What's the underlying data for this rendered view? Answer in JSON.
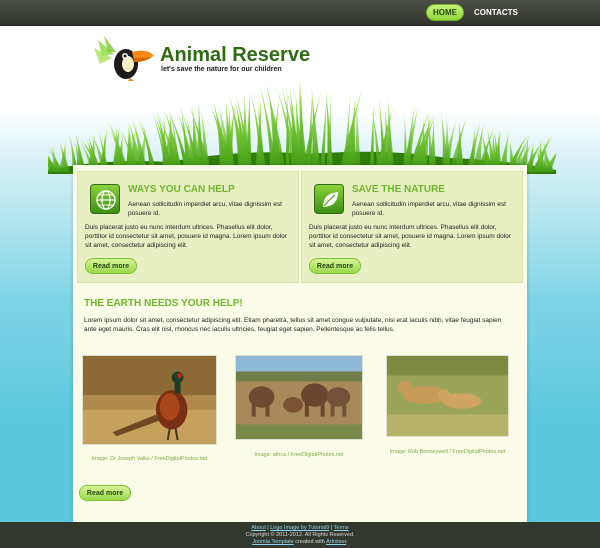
{
  "nav": {
    "home": "HOME",
    "contacts": "CONTACTS"
  },
  "header": {
    "title": "Animal Reserve",
    "slogan": "let's save the nature for our children",
    "logo_icon": "toucan-icon"
  },
  "features": [
    {
      "icon": "globe-icon",
      "title": "WAYS YOU CAN HELP",
      "intro": "Aenean sollicitudin imperdiet arcu, vitae dignissim est posuere id.",
      "body": "Duis placerat justo eu nunc interdum ultrices. Phasellus elit dolor, porttitor id consectetur sit amet, posuere id magna. Lorem ipsum dolor sit amet, consectetur adipiscing elit.",
      "button": "Read more"
    },
    {
      "icon": "leaf-icon",
      "title": "SAVE THE NATURE",
      "intro": "Aenean sollicitudin imperdiet arcu, vitae dignissim est posuere id.",
      "body": "Duis placerat justo eu nunc interdum ultrices. Phasellus elit dolor, porttitor id consectetur sit amet, posuere id magna. Lorem ipsum dolor sit amet, consectetur adipiscing elit.",
      "button": "Read more"
    }
  ],
  "main": {
    "title": "THE EARTH NEEDS YOUR HELP!",
    "text": "Lorem ipsum dolor sit amet, consectetur adipiscing elit. Etiam pharetra, tellus sit amet congue vulputate, nisi erat iaculis nibh, vitae feugiat sapien ante eget mauris. Cras elit nisl, rhoncus nec iaculis ultricies, feugiat eget sapien. Pellentesque ac felis tellus.",
    "photos": [
      {
        "subject": "pheasant",
        "caption": "Image: Dr Joseph Valks / FreeDigitalPhotos.net"
      },
      {
        "subject": "elephants",
        "caption": "Image: africa / FreeDigitalPhotos.net"
      },
      {
        "subject": "lionesses",
        "caption": "Image: Rob Bonneywell / FreeDigitalPhotos.net"
      }
    ],
    "button": "Read more"
  },
  "footer": {
    "link_about": "About",
    "sep1": " | ",
    "link_logo": "Logo Image by Tutorial9",
    "sep2": " | ",
    "link_terms": "Terms",
    "copyright": "Copyright © 2011-2012. All Rights Reserved.",
    "link_joomla": "Joomla Template",
    "created_with": " created with ",
    "link_artisteer": "Artisteer",
    "end": "."
  },
  "colors": {
    "accent_green": "#6fb62a",
    "title_green": "#2f6d12",
    "panel_bg": "#fcfde8",
    "feature_bg": "#e7efc3",
    "sky_blue": "#5cc8df",
    "footer_bg": "#33382f"
  }
}
